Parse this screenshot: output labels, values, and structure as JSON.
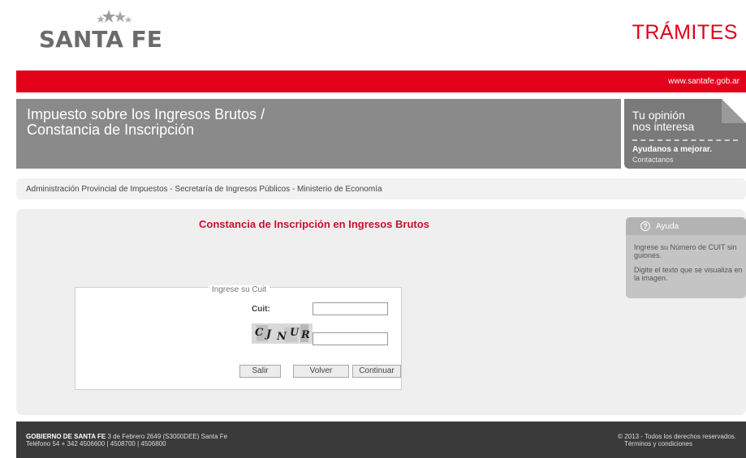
{
  "header": {
    "logo_text": "SANTA FE",
    "section_title": "TRÁMITES",
    "site_url": "www.santafe.gob.ar"
  },
  "banner": {
    "title_line1": "Impuesto sobre los Ingresos Brutos  /",
    "title_line2": "Constancia de Inscripción"
  },
  "feedback": {
    "line1": "Tu opinión",
    "line2": "nos interesa",
    "cta": "Ayudanos a mejorar.",
    "link": "Contactanos"
  },
  "breadcrumb": "Administración Provincial de Impuestos - Secretaría de Ingresos Públicos - Ministerio de Economía",
  "form": {
    "heading": "Constancia de Inscripción en Ingresos Brutos",
    "legend": "Ingrese su Cuit",
    "cuit_label": "Cuit:",
    "cuit_value": "",
    "captcha_text": "CJNUR",
    "captcha_value": "",
    "buttons": {
      "salir": "Salir",
      "volver": "Volver",
      "continuar": "Continuar"
    }
  },
  "help": {
    "title": "Ayuda",
    "text1": "Ingrese su Número de CUIT sin guiones.",
    "text2": "Digite el texto que se visualiza en la imagen."
  },
  "footer": {
    "org_bold": "GOBIERNO DE SANTA FE",
    "address": " 3 de Febrero 2649 (S3000DEE) Santa Fe",
    "phone": "Teléfono 54 + 342 4506600 | 4508700 | 4506800",
    "copyright": "© 2013 - Todos los derechos reservados.",
    "terms": "Términos y condiciones"
  },
  "colors": {
    "brand_red": "#e2001a",
    "banner_gray": "#8a8a8a",
    "footer_dark": "#3a3a3a"
  }
}
